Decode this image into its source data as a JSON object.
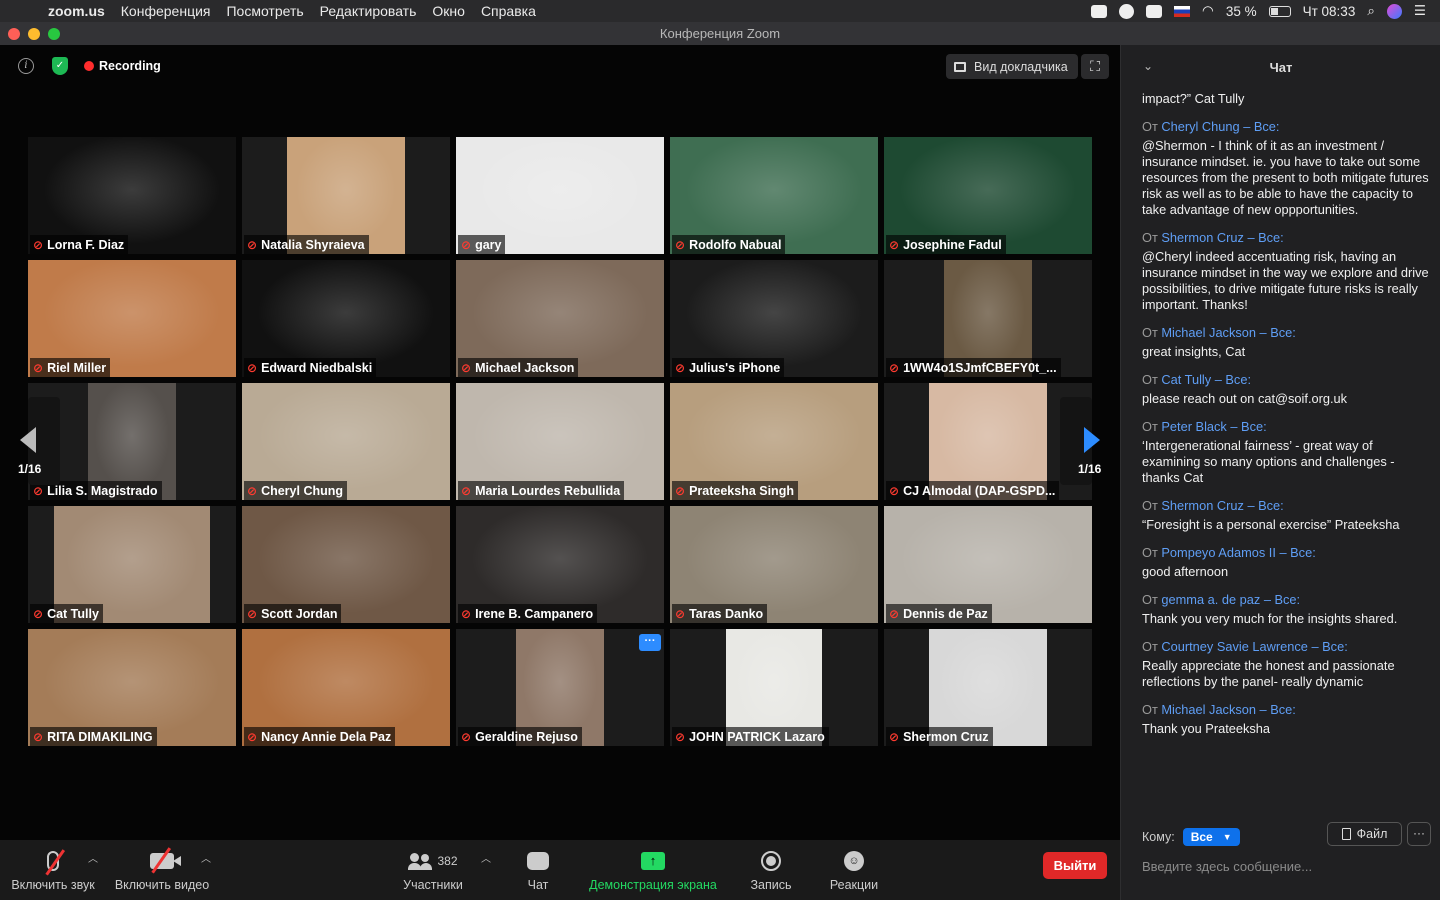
{
  "menubar": {
    "app": "zoom.us",
    "items": [
      "Конференция",
      "Посмотреть",
      "Редактировать",
      "Окно",
      "Справка"
    ],
    "battery": "35 %",
    "clock": "Чт 08:33"
  },
  "window": {
    "title": "Конференция Zoom"
  },
  "topbar": {
    "recording": "Recording",
    "speaker_view": "Вид докладчика"
  },
  "pagination": {
    "left": "1/16",
    "right": "1/16"
  },
  "participants": [
    {
      "name": "Lorna F. Diaz",
      "bg": "#111111"
    },
    {
      "name": "Natalia Shyraieva",
      "bg": "#c9a27a"
    },
    {
      "name": "gary",
      "bg": "#e9e9e9"
    },
    {
      "name": "Rodolfo Nabual",
      "bg": "#3f6e52"
    },
    {
      "name": "Josephine Fadul",
      "bg": "#1e4a32"
    },
    {
      "name": "Riel Miller",
      "bg": "#c07b4a"
    },
    {
      "name": "Edward Niedbalski",
      "bg": "#111111"
    },
    {
      "name": "Michael Jackson",
      "bg": "#7e6a5a"
    },
    {
      "name": "Julius's iPhone",
      "bg": "#1c1c1c"
    },
    {
      "name": "1WW4o1SJmfCBEFY0t_...",
      "bg": "#6b5a44"
    },
    {
      "name": "Lilia S. Magistrado",
      "bg": "#55504c"
    },
    {
      "name": "Cheryl Chung",
      "bg": "#b9aa95"
    },
    {
      "name": "Maria Lourdes Rebullida",
      "bg": "#bfb7ad"
    },
    {
      "name": "Prateeksha Singh",
      "bg": "#b79e7e"
    },
    {
      "name": "CJ Almodal (DAP-GSPD...",
      "bg": "#d7b9a3"
    },
    {
      "name": "Cat Tully",
      "bg": "#a28a74"
    },
    {
      "name": "Scott Jordan",
      "bg": "#6f5846"
    },
    {
      "name": "Irene B. Campanero",
      "bg": "#2e2b2a"
    },
    {
      "name": "Taras Danko",
      "bg": "#8e8474"
    },
    {
      "name": "Dennis de Paz",
      "bg": "#b7b2aa"
    },
    {
      "name": "RITA DIMAKILING",
      "bg": "#a47c58"
    },
    {
      "name": "Nancy Annie Dela Paz",
      "bg": "#b07040"
    },
    {
      "name": "Geraldine Rejuso",
      "bg": "#8f7868"
    },
    {
      "name": "JOHN PATRICK Lazaro",
      "bg": "#e8e8e4"
    },
    {
      "name": "Shermon Cruz",
      "bg": "#d8d8d8"
    }
  ],
  "toolbar": {
    "audio": "Включить звук",
    "video": "Включить видео",
    "participants_count": "382",
    "participants": "Участники",
    "chat": "Чат",
    "share": "Демонстрация экрана",
    "record": "Запись",
    "reactions": "Реакции",
    "leave": "Выйти"
  },
  "chat": {
    "title": "Чат",
    "cutoff_line": "impact?” Cat Tully",
    "messages": [
      {
        "prefix": "От",
        "from": "Cheryl Chung – Все:",
        "text": "@Shermon - I think of it as an investment / insurance mindset. ie. you have to take out some resources from the present to both mitigate futures risk as well as to be able to have the capacity to take advantage of new oppportunities."
      },
      {
        "prefix": "От",
        "from": "Shermon Cruz – Все:",
        "text": "@Cheryl indeed accentuating risk, having an insurance mindset in the way we explore and drive possibilities, to drive mitigate future risks is really important. Thanks!"
      },
      {
        "prefix": "От",
        "from": "Michael Jackson – Все:",
        "text": "great insights, Cat"
      },
      {
        "prefix": "От",
        "from": "Cat Tully – Все:",
        "text": "please reach out on cat@soif.org.uk"
      },
      {
        "prefix": "От",
        "from": "Peter Black – Все:",
        "text": "‘Intergenerational fairness’ - great way of examining so many options and challenges - thanks Cat"
      },
      {
        "prefix": "От",
        "from": "Shermon Cruz – Все:",
        "text": "“Foresight is a personal exercise” Prateeksha"
      },
      {
        "prefix": "От",
        "from": "Pompeyo Adamos II – Все:",
        "text": "good afternoon"
      },
      {
        "prefix": "От",
        "from": "gemma a. de paz – Все:",
        "text": "Thank you very much for the insights shared."
      },
      {
        "prefix": "От",
        "from": "Courtney Savie Lawrence – Все:",
        "text": "Really appreciate the honest and passionate reflections by the panel- really dynamic"
      },
      {
        "prefix": "От",
        "from": "Michael Jackson – Все:",
        "text": "Thank you Prateeksha"
      }
    ],
    "to_label": "Кому:",
    "to_value": "Все",
    "file": "Файл",
    "placeholder": "Введите здесь сообщение..."
  }
}
